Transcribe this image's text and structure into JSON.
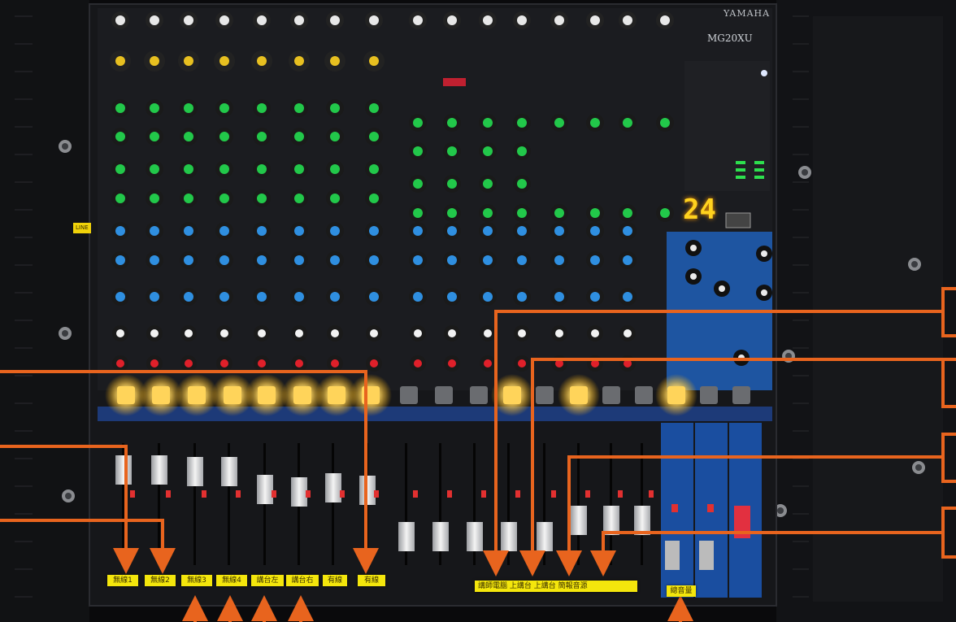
{
  "mixer": {
    "brand": "YAMAHA",
    "model": "MG20XU",
    "display_value": "24",
    "side_tag": "LINE",
    "mono_channel_count": 12,
    "stereo_channel_count": 4
  },
  "channel_labels": [
    {
      "text": "無線1",
      "lit": true
    },
    {
      "text": "無線2",
      "lit": true
    },
    {
      "text": "無線3",
      "lit": true
    },
    {
      "text": "無線4",
      "lit": true
    },
    {
      "text": "講台左",
      "lit": true
    },
    {
      "text": "講台右",
      "lit": true
    },
    {
      "text": "有線",
      "lit": true
    },
    {
      "text": "有線",
      "lit": true
    }
  ],
  "group_label": "講師電腦  上講台  上講台  簡報音源",
  "master_label": "總音量",
  "colors": {
    "annotation": "#e8641e",
    "label_bg": "#f4e60c",
    "panel": "#16171a",
    "knob_green": "#22c84a",
    "knob_blue": "#2f8fe0",
    "knob_yellow": "#e8c020",
    "knob_red": "#e0202a",
    "button_lit": "#ffd45a",
    "stereo_blue": "#1f5fb8"
  },
  "icons": [
    "yamaha-logo-icon",
    "led-meter-icon",
    "arrow-icon"
  ]
}
